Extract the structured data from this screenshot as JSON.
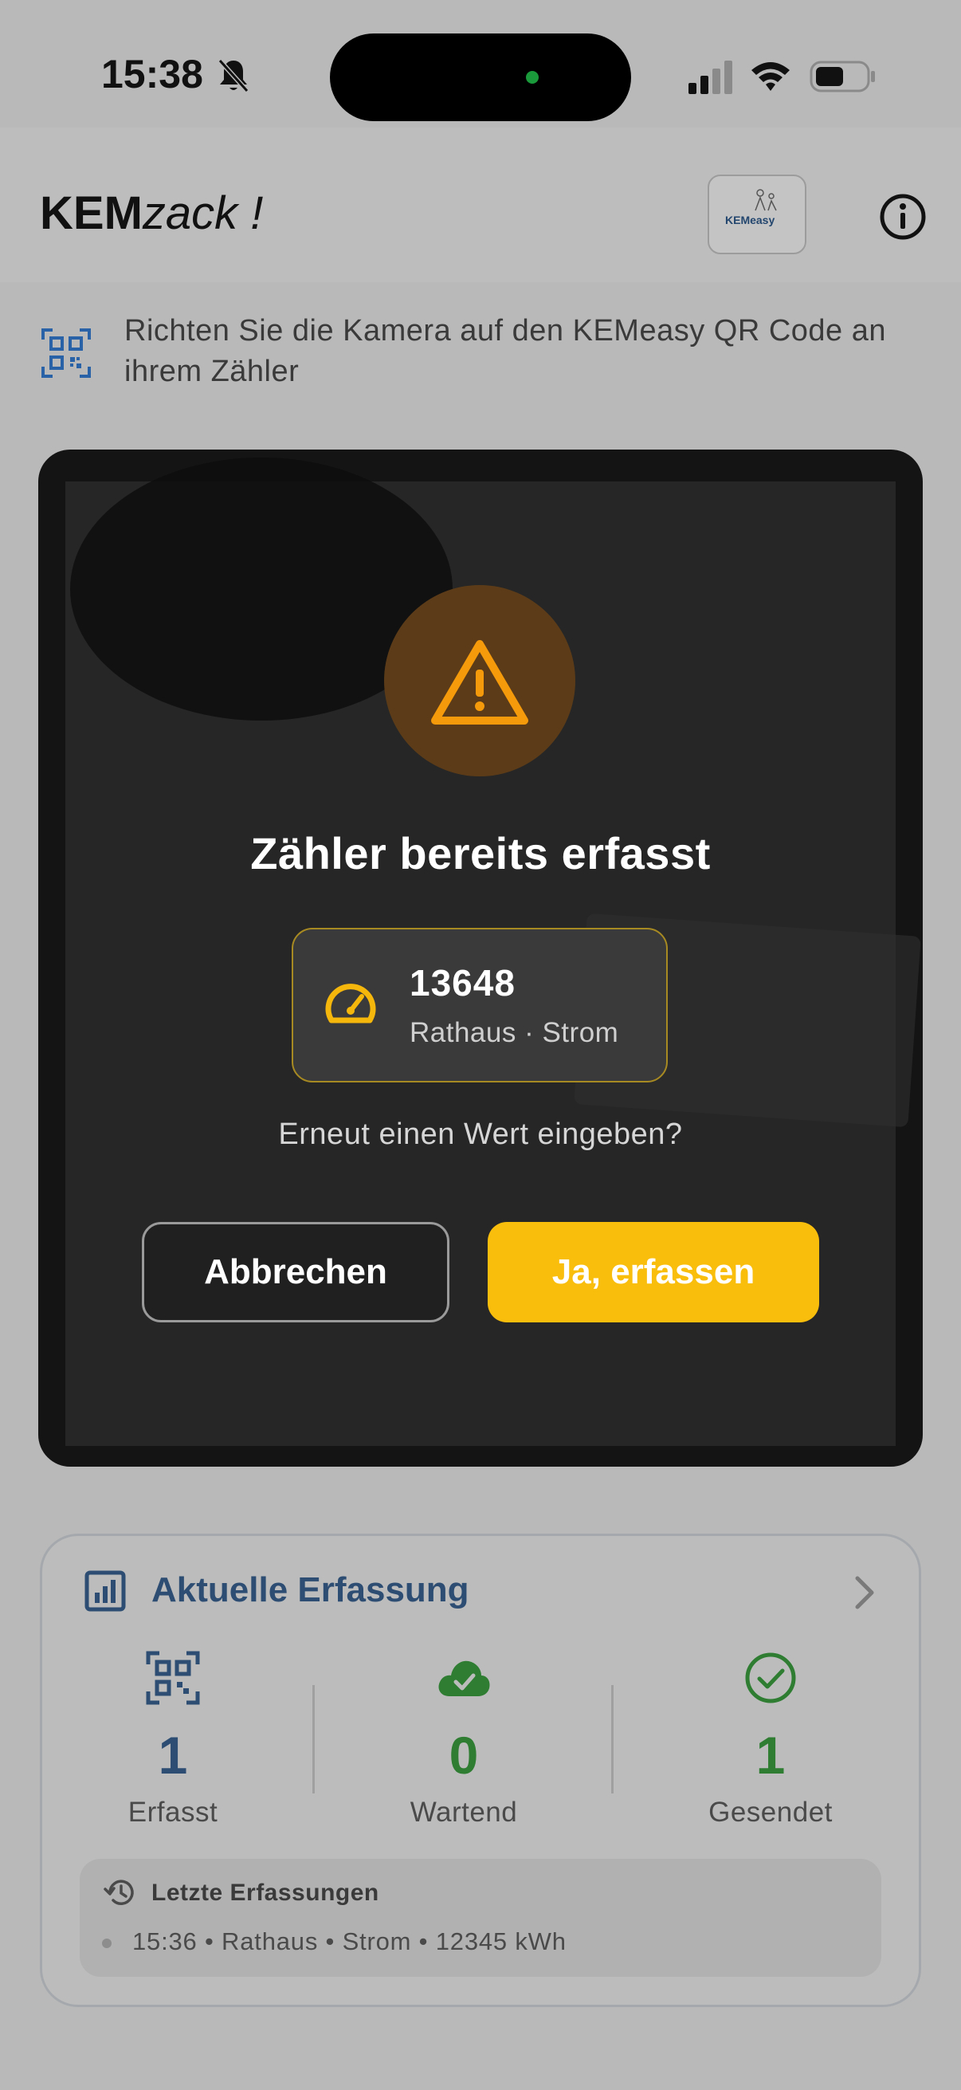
{
  "status_bar": {
    "time": "15:38"
  },
  "header": {
    "brand_bold": "KEM",
    "brand_italic": "zack !",
    "logo_text": "KEMeasy"
  },
  "hint": {
    "text": "Richten Sie die Kamera auf den KEMeasy QR Code an ihrem Zähler"
  },
  "dialog": {
    "title": "Zähler bereits erfasst",
    "meter_id": "13648",
    "meter_location": "Rathaus · Strom",
    "question": "Erneut einen Wert eingeben?",
    "cancel_label": "Abbrechen",
    "confirm_label": "Ja, erfassen",
    "accent_color": "#f9bd0c"
  },
  "stats": {
    "title": "Aktuelle Erfassung",
    "columns": [
      {
        "icon": "qr-code-icon",
        "value": "1",
        "label": "Erfasst",
        "color": "#2d4d72"
      },
      {
        "icon": "cloud-check-icon",
        "value": "0",
        "label": "Wartend",
        "color": "#2e7d32"
      },
      {
        "icon": "check-circle-icon",
        "value": "1",
        "label": "Gesendet",
        "color": "#2e7d32"
      }
    ],
    "recent_title": "Letzte Erfassungen",
    "recent_items": [
      "15:36 • Rathaus • Strom • 12345 kWh"
    ]
  }
}
